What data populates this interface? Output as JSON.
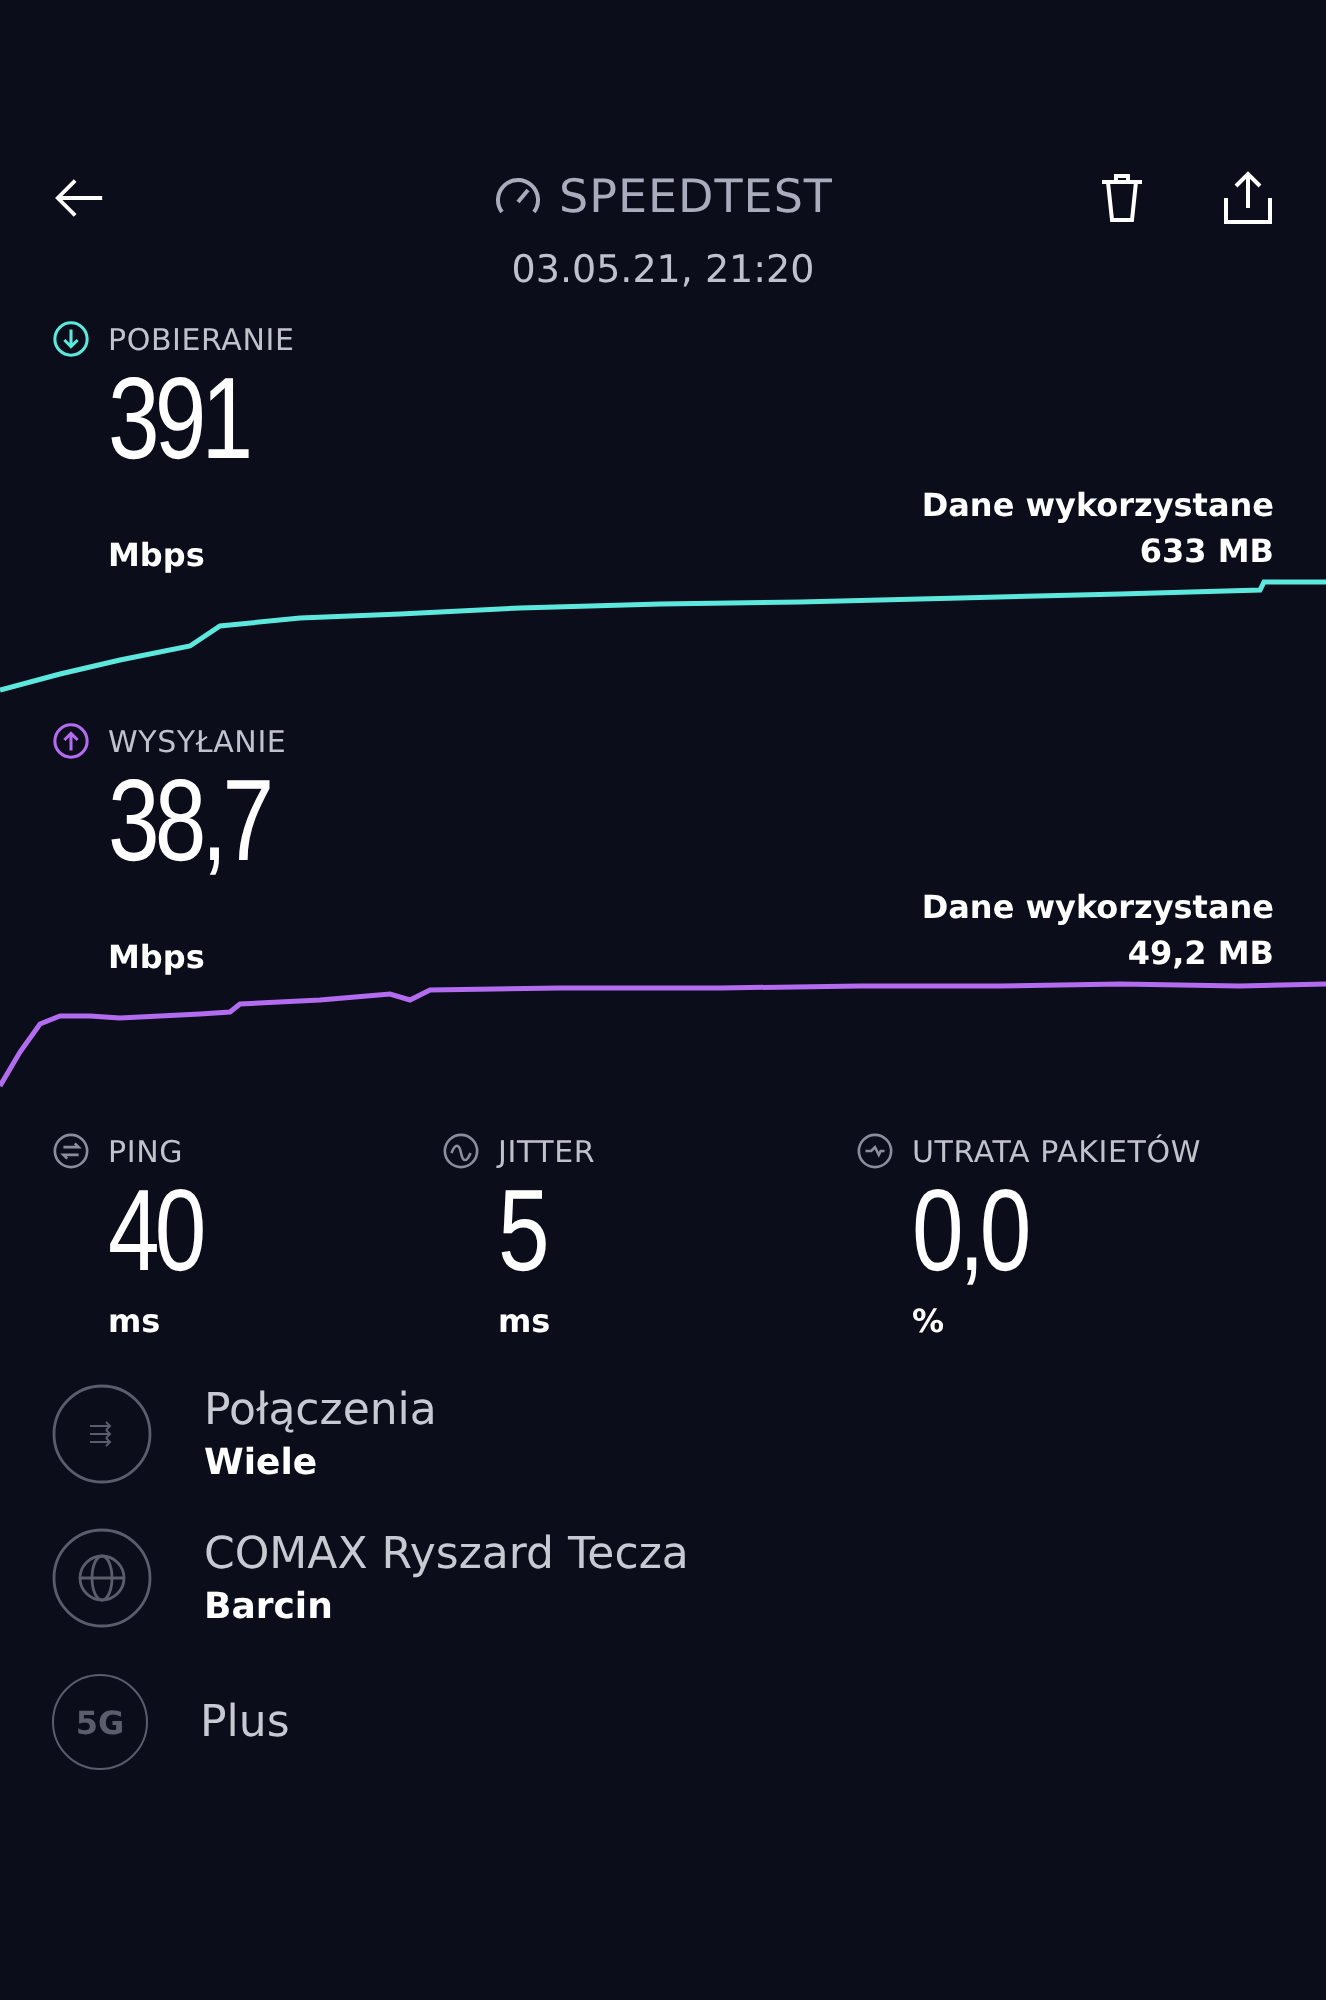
{
  "header": {
    "title": "SPEEDTEST",
    "date": "03.05.21, 21:20"
  },
  "results": [
    {
      "kind": "download",
      "label": "POBIERANIE",
      "value": "391",
      "unit": "Mbps",
      "data_label": "Dane wykorzystane",
      "data_value": "633 MB",
      "color": "#5ce8dc"
    },
    {
      "kind": "upload",
      "label": "WYSYŁANIE",
      "value": "38,7",
      "unit": "Mbps",
      "data_label": "Dane wykorzystane",
      "data_value": "49,2 MB",
      "color": "#b36cf0"
    }
  ],
  "stats": [
    {
      "kind": "ping",
      "label": "PING",
      "value": "40",
      "unit": "ms"
    },
    {
      "kind": "jitter",
      "label": "JITTER",
      "value": "5",
      "unit": "ms"
    },
    {
      "kind": "loss",
      "label": "UTRATA PAKIETÓW",
      "value": "0,0",
      "unit": "%"
    }
  ],
  "info": [
    {
      "kind": "connections",
      "title": "Połączenia",
      "subtitle": "Wiele"
    },
    {
      "kind": "server",
      "title": "COMAX Ryszard Tecza",
      "subtitle": "Barcin"
    },
    {
      "kind": "network",
      "badge": "5G",
      "title": "Plus"
    }
  ]
}
